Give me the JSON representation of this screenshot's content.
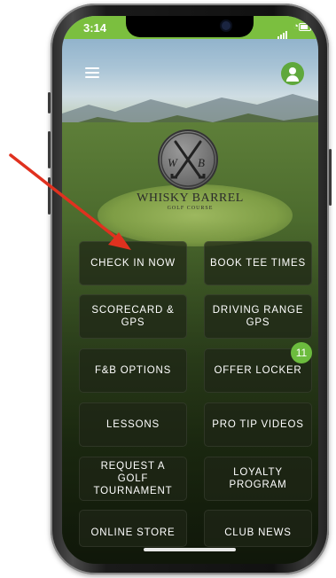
{
  "status_bar": {
    "time": "3:14"
  },
  "brand": {
    "name": "WHISKY BARREL",
    "sub": "GOLF COURSE",
    "monogram_left": "W",
    "monogram_right": "B"
  },
  "tiles": [
    {
      "label": "CHECK IN NOW"
    },
    {
      "label": "BOOK TEE TIMES"
    },
    {
      "label": "SCORECARD & GPS"
    },
    {
      "label": "DRIVING RANGE GPS"
    },
    {
      "label": "F&B OPTIONS"
    },
    {
      "label": "OFFER LOCKER",
      "badge": "11"
    },
    {
      "label": "LESSONS"
    },
    {
      "label": "PRO TIP VIDEOS"
    },
    {
      "label": "REQUEST A GOLF TOURNAMENT"
    },
    {
      "label": "LOYALTY PROGRAM"
    },
    {
      "label": "ONLINE STORE"
    },
    {
      "label": "CLUB NEWS"
    }
  ],
  "icons": {
    "menu": "hamburger-menu-icon",
    "profile": "user-profile-icon",
    "logo": "crossed-clubs-logo",
    "annotation": "red-arrow"
  },
  "colors": {
    "accent_green": "#7bbf3f",
    "badge_green": "#6cbc3e",
    "arrow_red": "#e0311f"
  }
}
